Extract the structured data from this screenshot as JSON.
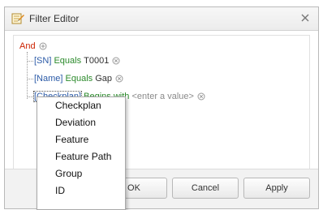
{
  "window": {
    "title": "Filter Editor",
    "title_icon": "filter-editor-icon",
    "close_icon": "close-x-icon"
  },
  "tree": {
    "group_operator": "And",
    "conditions": [
      {
        "field": "[SN]",
        "operator": "Equals",
        "value": "T0001",
        "placeholder": false
      },
      {
        "field": "[Name]",
        "operator": "Equals",
        "value": "Gap",
        "placeholder": false
      },
      {
        "field": "[Checkplan]",
        "operator": "Begins with",
        "value": "<enter a value>",
        "placeholder": true
      }
    ]
  },
  "dropdown": {
    "items": [
      "Checkplan",
      "Deviation",
      "Feature",
      "Feature Path",
      "Group",
      "ID"
    ]
  },
  "buttons": {
    "ok": "OK",
    "cancel": "Cancel",
    "apply": "Apply"
  },
  "colors": {
    "and_operator": "#cc2200",
    "field": "#2b5aa7",
    "operator": "#2b8a2b",
    "placeholder": "#8a8a8a"
  }
}
